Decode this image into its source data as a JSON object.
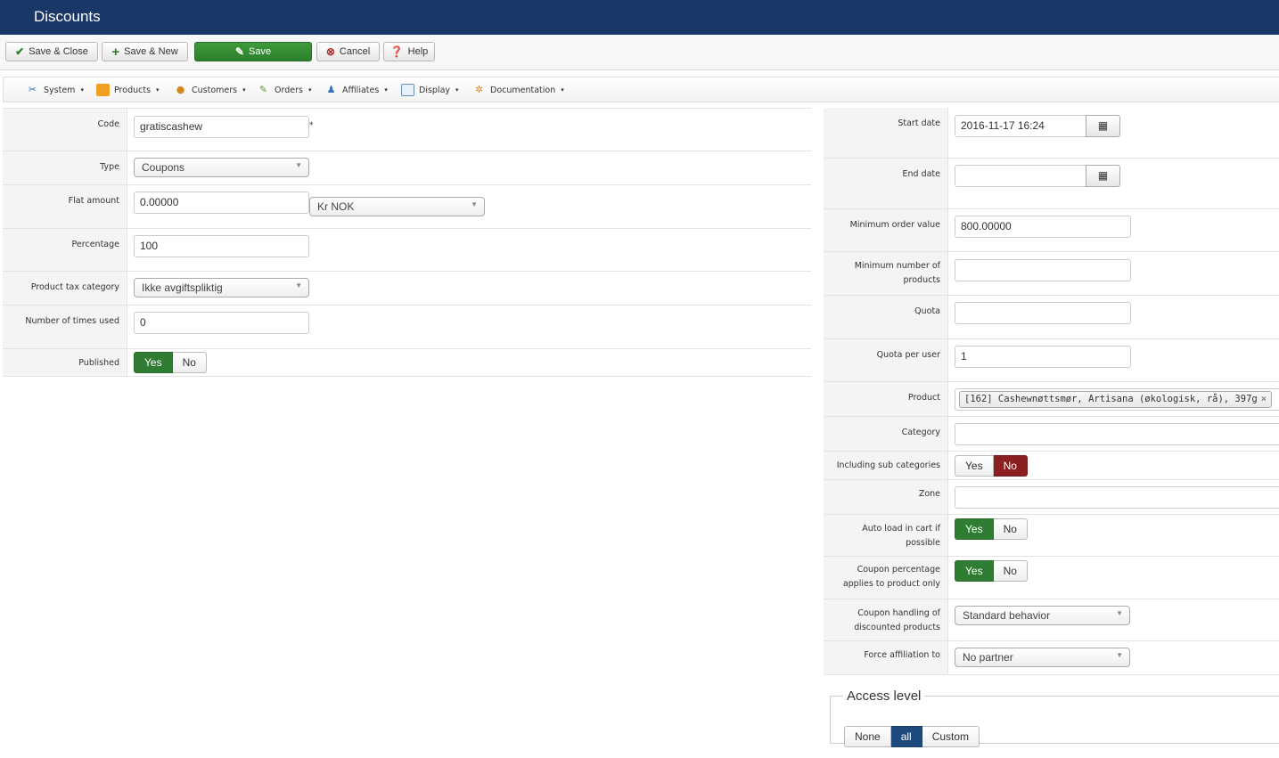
{
  "header": {
    "title": "Discounts"
  },
  "toolbar": {
    "save_close": "Save & Close",
    "save_new": "Save & New",
    "save": "Save",
    "cancel": "Cancel",
    "help": "Help"
  },
  "menu": [
    {
      "label": "System",
      "icon": "tools-icon"
    },
    {
      "label": "Products",
      "icon": "products-icon"
    },
    {
      "label": "Customers",
      "icon": "customers-icon"
    },
    {
      "label": "Orders",
      "icon": "orders-icon"
    },
    {
      "label": "Affiliates",
      "icon": "affiliates-icon"
    },
    {
      "label": "Display",
      "icon": "display-icon"
    },
    {
      "label": "Documentation",
      "icon": "documentation-icon"
    }
  ],
  "left": {
    "code": {
      "label": "Code",
      "value": "gratiscashew",
      "required_mark": "*"
    },
    "type": {
      "label": "Type",
      "value": "Coupons"
    },
    "flat_amount": {
      "label": "Flat amount",
      "value": "0.00000",
      "currency": "Kr NOK"
    },
    "percentage": {
      "label": "Percentage",
      "value": "100"
    },
    "tax_category": {
      "label": "Product tax category",
      "value": "Ikke avgiftspliktig"
    },
    "times_used": {
      "label": "Number of times used",
      "value": "0"
    },
    "published": {
      "label": "Published",
      "yes": "Yes",
      "no": "No",
      "selected": "Yes"
    }
  },
  "right": {
    "start_date": {
      "label": "Start date",
      "value": "2016-11-17 16:24"
    },
    "end_date": {
      "label": "End date",
      "value": ""
    },
    "min_order": {
      "label": "Minimum order value",
      "value": "800.00000"
    },
    "min_products": {
      "label": "Minimum number of products",
      "value": ""
    },
    "quota": {
      "label": "Quota",
      "value": ""
    },
    "quota_user": {
      "label": "Quota per user",
      "value": "1"
    },
    "product": {
      "label": "Product",
      "tag": "[162] Cashewnøttsmør, Artisana (økologisk, rå), 397g",
      "remove": "×"
    },
    "category": {
      "label": "Category",
      "value": ""
    },
    "sub_categories": {
      "label": "Including sub categories",
      "yes": "Yes",
      "no": "No",
      "selected": "No"
    },
    "zone": {
      "label": "Zone",
      "value": ""
    },
    "auto_load": {
      "label": "Auto load in cart if possible",
      "yes": "Yes",
      "no": "No",
      "selected": "Yes"
    },
    "coupon_pct": {
      "label": "Coupon percentage applies to product only",
      "yes": "Yes",
      "no": "No",
      "selected": "Yes"
    },
    "coupon_handling": {
      "label": "Coupon handling of discounted products",
      "value": "Standard behavior"
    },
    "force_affiliation": {
      "label": "Force affiliation to",
      "value": "No partner"
    }
  },
  "access": {
    "legend": "Access level",
    "options": [
      "None",
      "all",
      "Custom"
    ],
    "selected": "all"
  },
  "colors": {
    "header": "#1a3867",
    "green": "#2f7d32",
    "red": "#8b1f1f",
    "blue": "#1e4a7e"
  }
}
